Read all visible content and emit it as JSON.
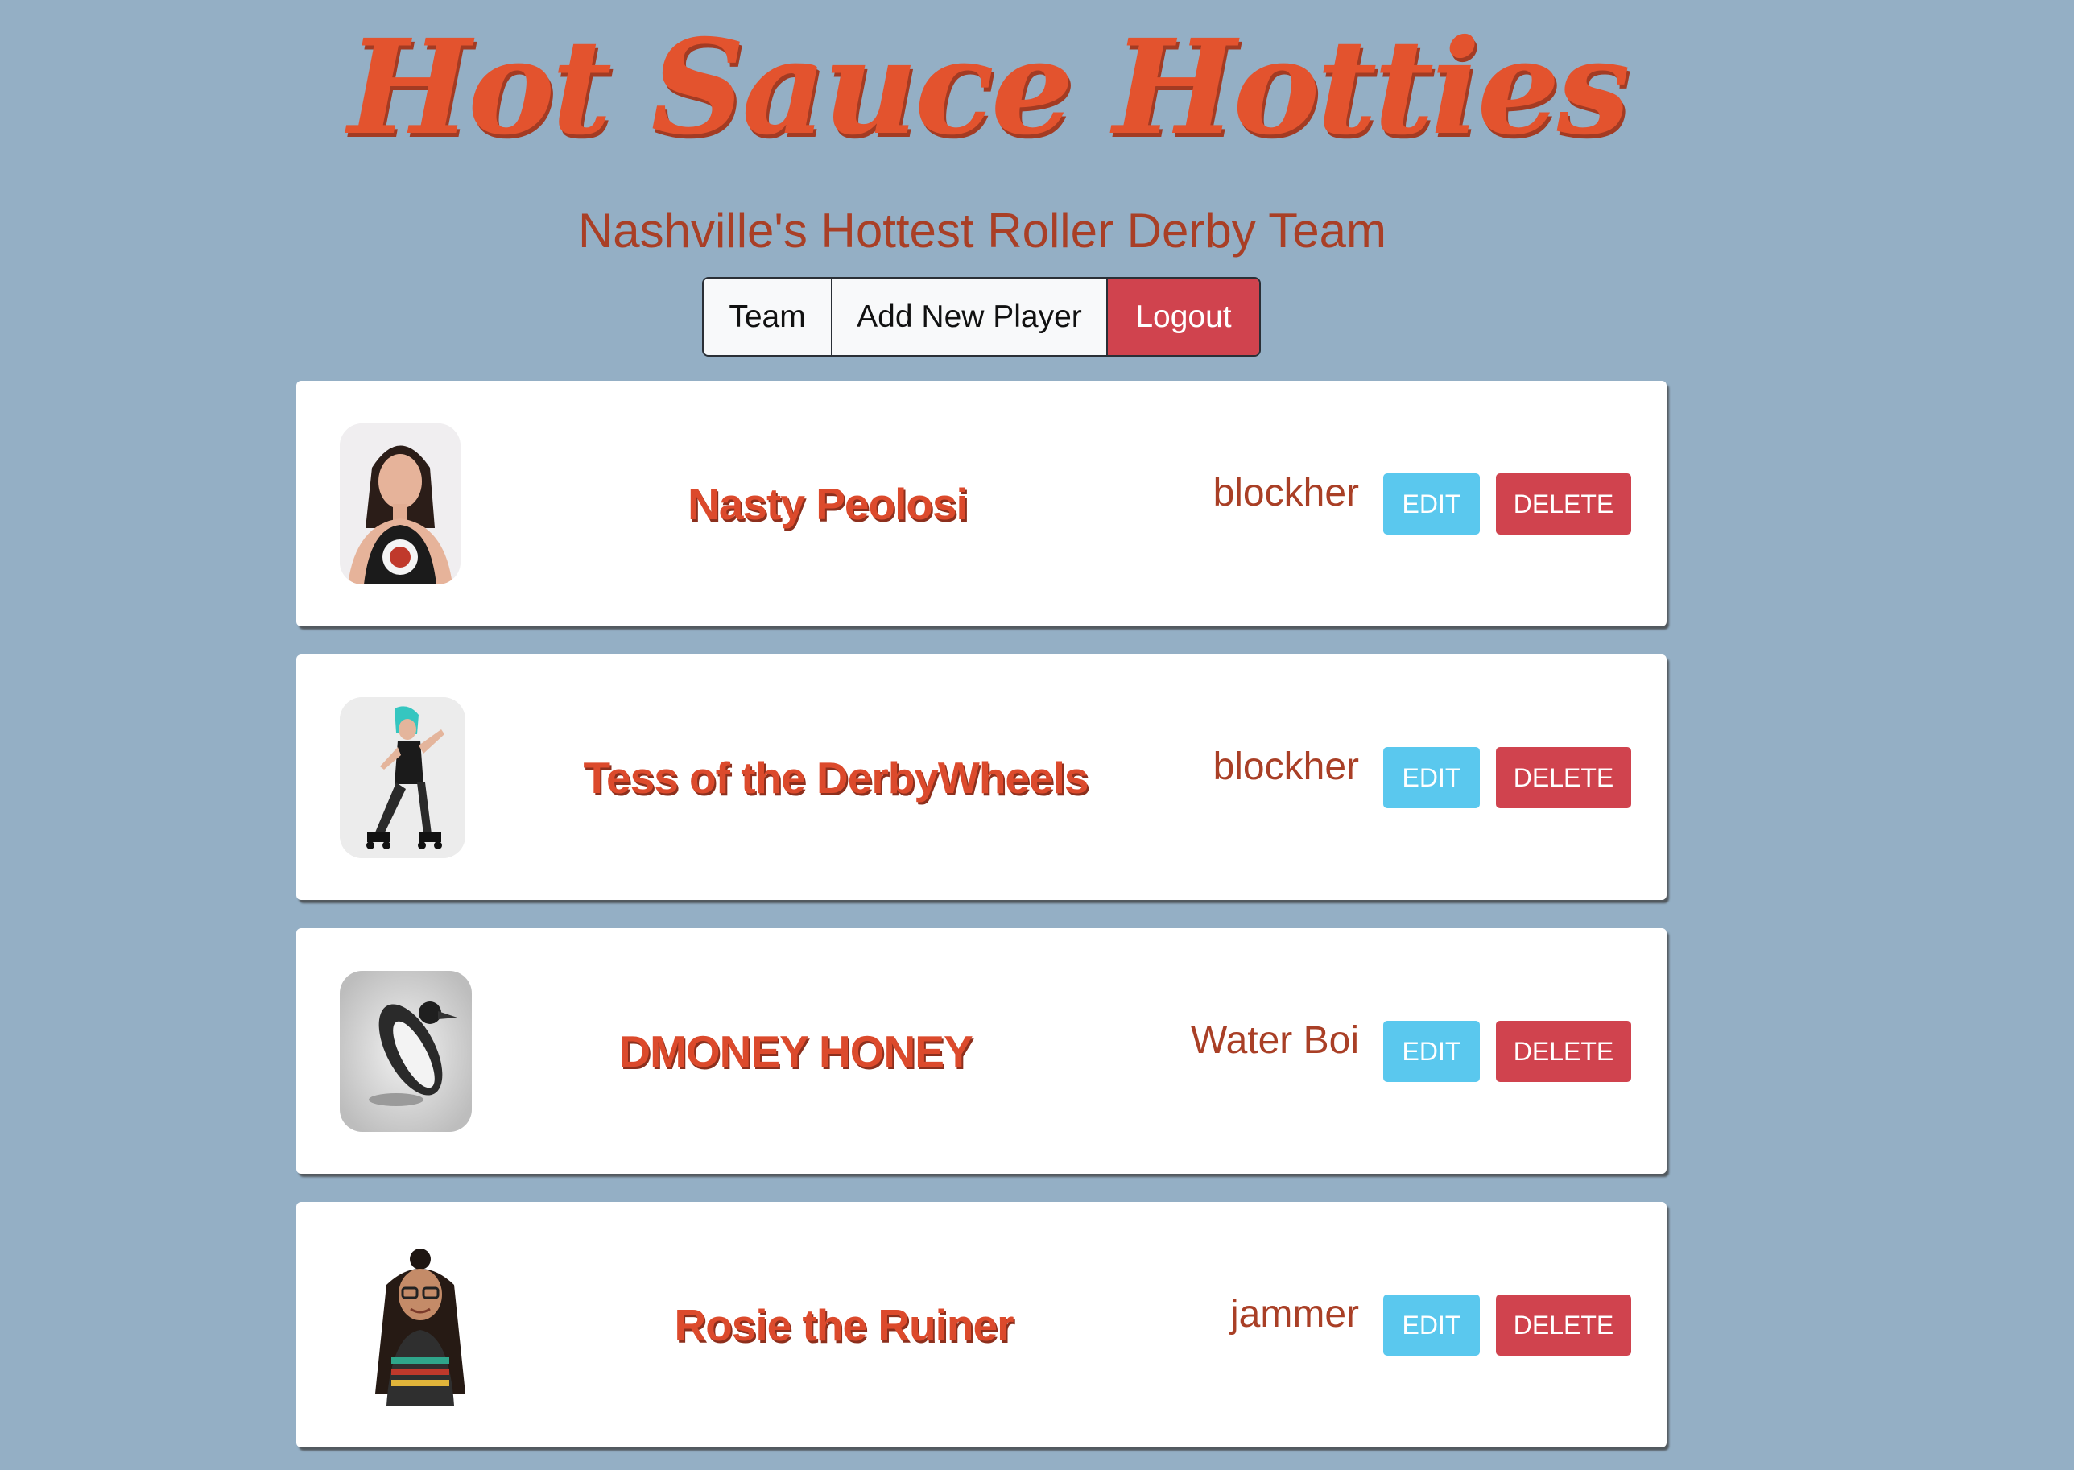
{
  "header": {
    "title": "Hot Sauce Hotties",
    "subtitle": "Nashville's Hottest Roller Derby Team"
  },
  "nav": {
    "team": "Team",
    "add_player": "Add New Player",
    "logout": "Logout"
  },
  "players": [
    {
      "name": "Nasty Peolosi",
      "position": "blockher",
      "edit": "EDIT",
      "delete": "DELETE"
    },
    {
      "name": "Tess of the DerbyWheels",
      "position": "blockher",
      "edit": "EDIT",
      "delete": "DELETE"
    },
    {
      "name": "DMONEY HONEY",
      "position": "Water Boi",
      "edit": "EDIT",
      "delete": "DELETE"
    },
    {
      "name": "Rosie the Ruiner",
      "position": "jammer",
      "edit": "EDIT",
      "delete": "DELETE"
    }
  ],
  "colors": {
    "background": "#94afc5",
    "title": "#e3532e",
    "subtitle": "#a93f26",
    "player_name": "#dc4a2c",
    "edit_button": "#5ac8ee",
    "delete_button": "#d0434e",
    "logout_button": "#d0434e"
  }
}
